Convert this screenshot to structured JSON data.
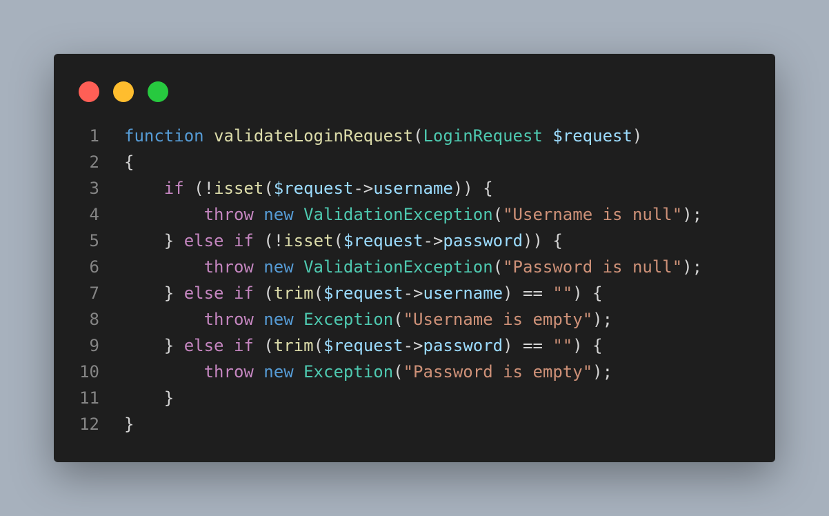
{
  "window": {
    "buttons": [
      {
        "name": "close",
        "color": "#ff5f56"
      },
      {
        "name": "minimize",
        "color": "#ffbd2e"
      },
      {
        "name": "maximize",
        "color": "#27c93f"
      }
    ]
  },
  "colors": {
    "kw": "#569cd6",
    "ctrl": "#c586c0",
    "fn": "#dcdcaa",
    "type": "#4ec9b0",
    "var": "#9cdcfe",
    "str": "#ce9178",
    "punc": "#d4d4d4"
  },
  "code": {
    "lines": [
      {
        "num": "1",
        "tokens": [
          {
            "t": "function",
            "c": "kw"
          },
          {
            "t": " ",
            "c": "punc"
          },
          {
            "t": "validateLoginRequest",
            "c": "fn"
          },
          {
            "t": "(",
            "c": "punc"
          },
          {
            "t": "LoginRequest",
            "c": "type"
          },
          {
            "t": " ",
            "c": "punc"
          },
          {
            "t": "$request",
            "c": "var"
          },
          {
            "t": ")",
            "c": "punc"
          }
        ]
      },
      {
        "num": "2",
        "tokens": [
          {
            "t": "{",
            "c": "punc"
          }
        ]
      },
      {
        "num": "3",
        "tokens": [
          {
            "t": "    ",
            "c": "punc"
          },
          {
            "t": "if",
            "c": "ctrl"
          },
          {
            "t": " (!",
            "c": "punc"
          },
          {
            "t": "isset",
            "c": "fn"
          },
          {
            "t": "(",
            "c": "punc"
          },
          {
            "t": "$request",
            "c": "var"
          },
          {
            "t": "->",
            "c": "punc"
          },
          {
            "t": "username",
            "c": "var"
          },
          {
            "t": ")) {",
            "c": "punc"
          }
        ]
      },
      {
        "num": "4",
        "tokens": [
          {
            "t": "        ",
            "c": "punc"
          },
          {
            "t": "throw",
            "c": "ctrl"
          },
          {
            "t": " ",
            "c": "punc"
          },
          {
            "t": "new",
            "c": "kw"
          },
          {
            "t": " ",
            "c": "punc"
          },
          {
            "t": "ValidationException",
            "c": "type"
          },
          {
            "t": "(",
            "c": "punc"
          },
          {
            "t": "\"Username is null\"",
            "c": "str"
          },
          {
            "t": ");",
            "c": "punc"
          }
        ]
      },
      {
        "num": "5",
        "tokens": [
          {
            "t": "    } ",
            "c": "punc"
          },
          {
            "t": "else",
            "c": "ctrl"
          },
          {
            "t": " ",
            "c": "punc"
          },
          {
            "t": "if",
            "c": "ctrl"
          },
          {
            "t": " (!",
            "c": "punc"
          },
          {
            "t": "isset",
            "c": "fn"
          },
          {
            "t": "(",
            "c": "punc"
          },
          {
            "t": "$request",
            "c": "var"
          },
          {
            "t": "->",
            "c": "punc"
          },
          {
            "t": "password",
            "c": "var"
          },
          {
            "t": ")) {",
            "c": "punc"
          }
        ]
      },
      {
        "num": "6",
        "tokens": [
          {
            "t": "        ",
            "c": "punc"
          },
          {
            "t": "throw",
            "c": "ctrl"
          },
          {
            "t": " ",
            "c": "punc"
          },
          {
            "t": "new",
            "c": "kw"
          },
          {
            "t": " ",
            "c": "punc"
          },
          {
            "t": "ValidationException",
            "c": "type"
          },
          {
            "t": "(",
            "c": "punc"
          },
          {
            "t": "\"Password is null\"",
            "c": "str"
          },
          {
            "t": ");",
            "c": "punc"
          }
        ]
      },
      {
        "num": "7",
        "tokens": [
          {
            "t": "    } ",
            "c": "punc"
          },
          {
            "t": "else",
            "c": "ctrl"
          },
          {
            "t": " ",
            "c": "punc"
          },
          {
            "t": "if",
            "c": "ctrl"
          },
          {
            "t": " (",
            "c": "punc"
          },
          {
            "t": "trim",
            "c": "fn"
          },
          {
            "t": "(",
            "c": "punc"
          },
          {
            "t": "$request",
            "c": "var"
          },
          {
            "t": "->",
            "c": "punc"
          },
          {
            "t": "username",
            "c": "var"
          },
          {
            "t": ") == ",
            "c": "punc"
          },
          {
            "t": "\"\"",
            "c": "str"
          },
          {
            "t": ") {",
            "c": "punc"
          }
        ]
      },
      {
        "num": "8",
        "tokens": [
          {
            "t": "        ",
            "c": "punc"
          },
          {
            "t": "throw",
            "c": "ctrl"
          },
          {
            "t": " ",
            "c": "punc"
          },
          {
            "t": "new",
            "c": "kw"
          },
          {
            "t": " ",
            "c": "punc"
          },
          {
            "t": "Exception",
            "c": "type"
          },
          {
            "t": "(",
            "c": "punc"
          },
          {
            "t": "\"Username is empty\"",
            "c": "str"
          },
          {
            "t": ");",
            "c": "punc"
          }
        ]
      },
      {
        "num": "9",
        "tokens": [
          {
            "t": "    } ",
            "c": "punc"
          },
          {
            "t": "else",
            "c": "ctrl"
          },
          {
            "t": " ",
            "c": "punc"
          },
          {
            "t": "if",
            "c": "ctrl"
          },
          {
            "t": " (",
            "c": "punc"
          },
          {
            "t": "trim",
            "c": "fn"
          },
          {
            "t": "(",
            "c": "punc"
          },
          {
            "t": "$request",
            "c": "var"
          },
          {
            "t": "->",
            "c": "punc"
          },
          {
            "t": "password",
            "c": "var"
          },
          {
            "t": ") == ",
            "c": "punc"
          },
          {
            "t": "\"\"",
            "c": "str"
          },
          {
            "t": ") {",
            "c": "punc"
          }
        ]
      },
      {
        "num": "10",
        "tokens": [
          {
            "t": "        ",
            "c": "punc"
          },
          {
            "t": "throw",
            "c": "ctrl"
          },
          {
            "t": " ",
            "c": "punc"
          },
          {
            "t": "new",
            "c": "kw"
          },
          {
            "t": " ",
            "c": "punc"
          },
          {
            "t": "Exception",
            "c": "type"
          },
          {
            "t": "(",
            "c": "punc"
          },
          {
            "t": "\"Password is empty\"",
            "c": "str"
          },
          {
            "t": ");",
            "c": "punc"
          }
        ]
      },
      {
        "num": "11",
        "tokens": [
          {
            "t": "    }",
            "c": "punc"
          }
        ]
      },
      {
        "num": "12",
        "tokens": [
          {
            "t": "}",
            "c": "punc"
          }
        ]
      }
    ]
  }
}
